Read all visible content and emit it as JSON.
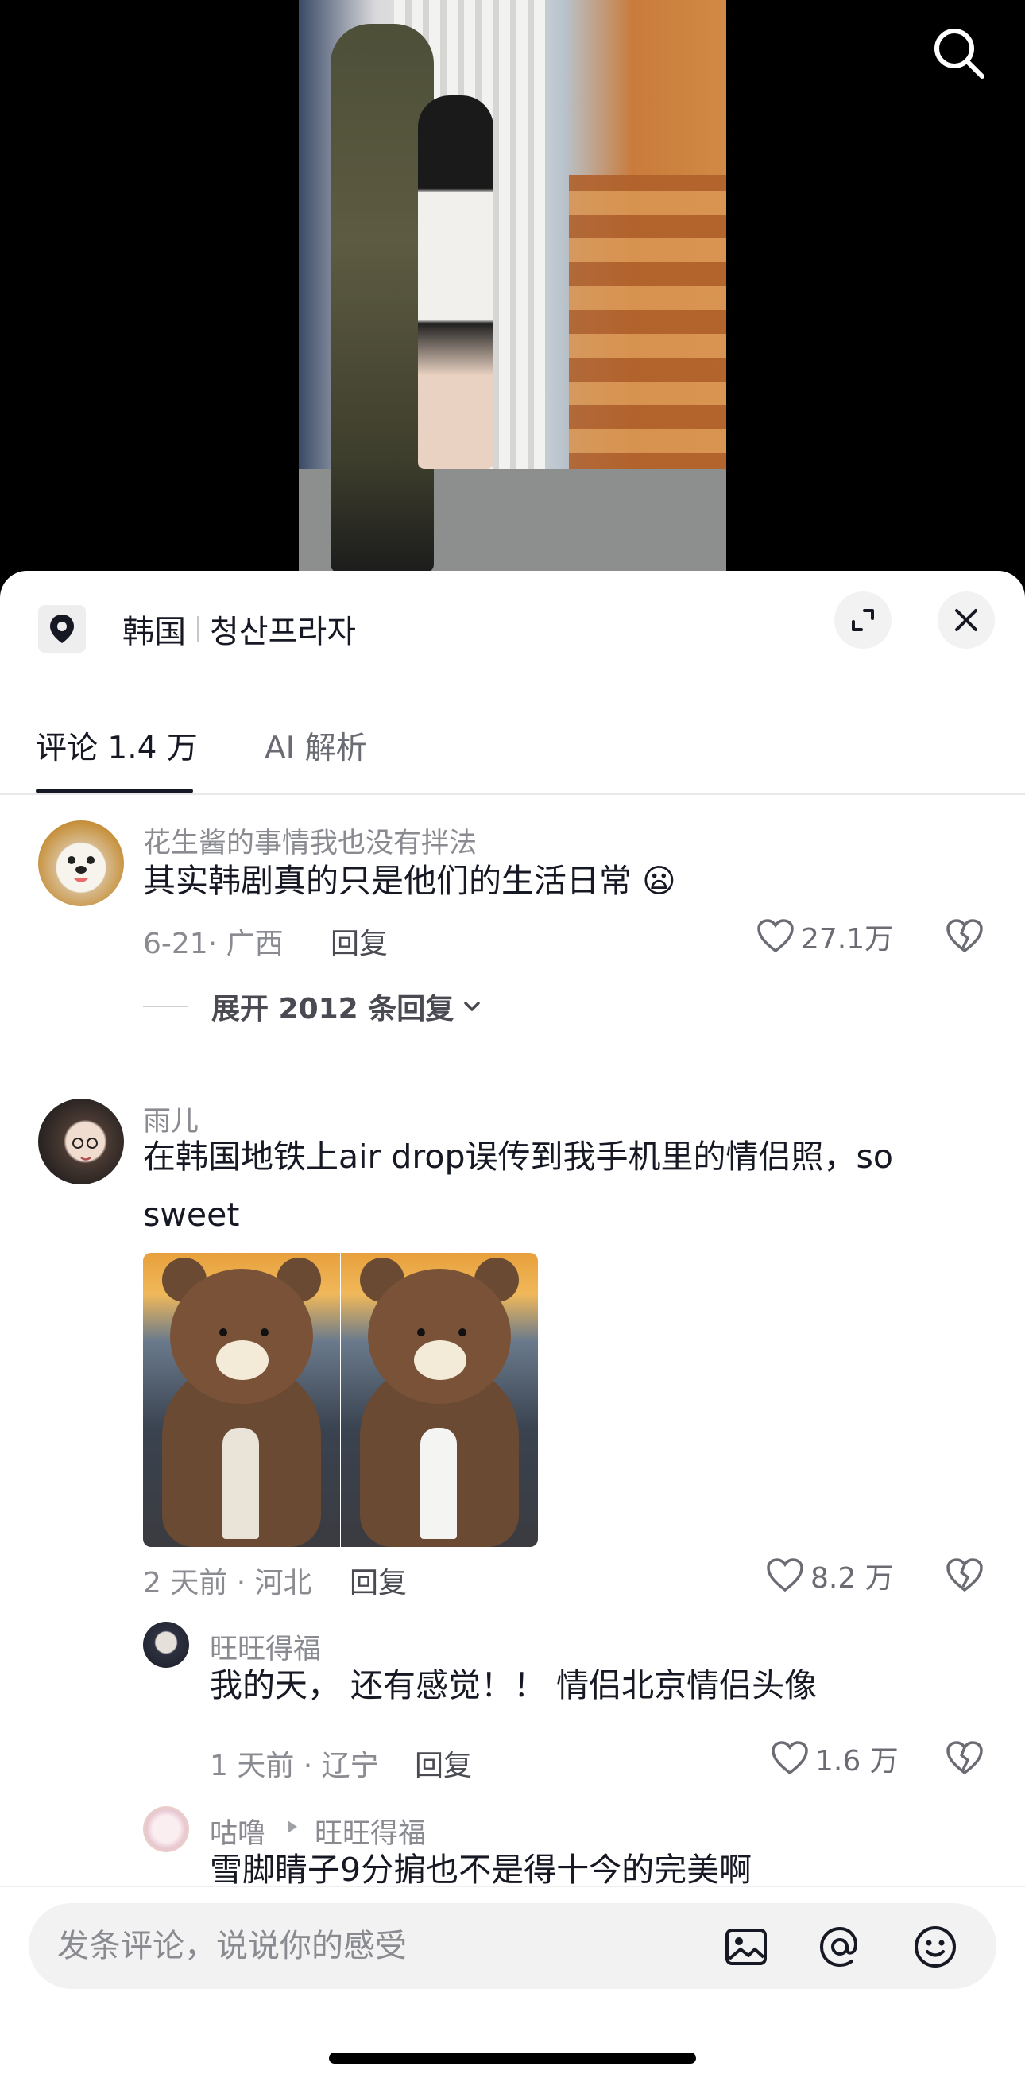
{
  "video": {
    "search_icon": "search-icon"
  },
  "location": {
    "country": "韩国",
    "place": "청산프라자",
    "pin_icon": "location-pin-icon"
  },
  "header": {
    "expand_icon": "expand-icon",
    "close_icon": "close-icon"
  },
  "tabs": [
    {
      "label": "评论 1.4 万",
      "active": true
    },
    {
      "label": "AI 解析",
      "active": false
    }
  ],
  "comments": [
    {
      "username": "花生酱的事情我也没有拌法",
      "text": "其实韩剧真的只是他们的生活日常 😦",
      "meta": "6-21· 广西",
      "reply_label": "回复",
      "likes": "27.1万",
      "expand_replies": "展开 2012 条回复"
    },
    {
      "username": "雨儿",
      "text": "在韩国地铁上air drop误传到我手机里的情侣照，so sweet",
      "meta": "2 天前 · 河北",
      "reply_label": "回复",
      "likes": "8.2 万",
      "replies": [
        {
          "username": "旺旺得福",
          "text": "我的天， 还有感觉！！ 情侣北京情侣头像",
          "meta": "1 天前 · 辽宁",
          "reply_label": "回复",
          "likes": "1.6 万"
        },
        {
          "username": "咕噜",
          "reply_to": "旺旺得福",
          "text": "雪脚睛子9分掮也不是得十今的完美啊"
        }
      ]
    }
  ],
  "input": {
    "placeholder": "发条评论，说说你的感受",
    "image_icon": "image-icon",
    "mention_icon": "at-mention-icon",
    "emoji_icon": "emoji-icon"
  },
  "colors": {
    "text_primary": "#161823",
    "text_secondary": "#8a8b91",
    "background": "#ffffff",
    "video_background": "#000000"
  }
}
